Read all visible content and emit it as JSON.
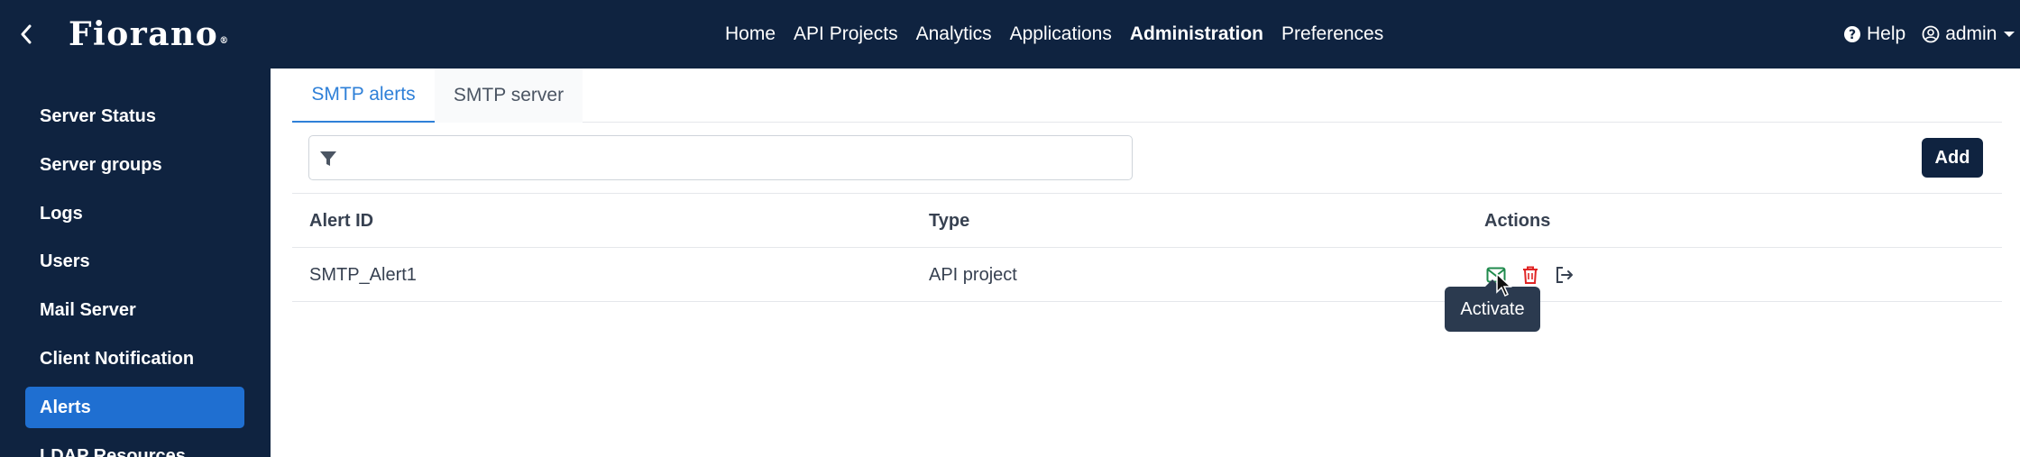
{
  "topbar": {
    "back_icon": "chevron-left-icon",
    "logo_text": "Fiorano",
    "logo_mark": "®",
    "nav": [
      {
        "label": "Home"
      },
      {
        "label": "API Projects"
      },
      {
        "label": "Analytics"
      },
      {
        "label": "Applications"
      },
      {
        "label": "Administration",
        "active": true
      },
      {
        "label": "Preferences"
      }
    ],
    "help_label": "Help",
    "user_label": "admin"
  },
  "sidebar": {
    "items": [
      {
        "label": "Server Status"
      },
      {
        "label": "Server groups"
      },
      {
        "label": "Logs"
      },
      {
        "label": "Users"
      },
      {
        "label": "Mail Server"
      },
      {
        "label": "Client Notification"
      },
      {
        "label": "Alerts",
        "active": true
      },
      {
        "label": "LDAP Resources"
      }
    ]
  },
  "main": {
    "tabs": [
      {
        "label": "SMTP alerts",
        "active": true
      },
      {
        "label": "SMTP server"
      }
    ],
    "filter": {
      "placeholder": "",
      "icon": "filter-icon"
    },
    "add_label": "Add",
    "table": {
      "columns": [
        "Alert ID",
        "Type",
        "Actions"
      ],
      "rows": [
        {
          "alert_id": "SMTP_Alert1",
          "type": "API project",
          "actions": [
            "mail-icon",
            "trash-icon",
            "sign-out-icon"
          ]
        }
      ]
    },
    "tooltip": "Activate"
  },
  "colors": {
    "navy": "#0f2340",
    "accent_blue": "#2f80d8",
    "active_sidebar": "#1f6fd1",
    "activate_green": "#1f8a4c",
    "delete_red": "#e02424"
  }
}
